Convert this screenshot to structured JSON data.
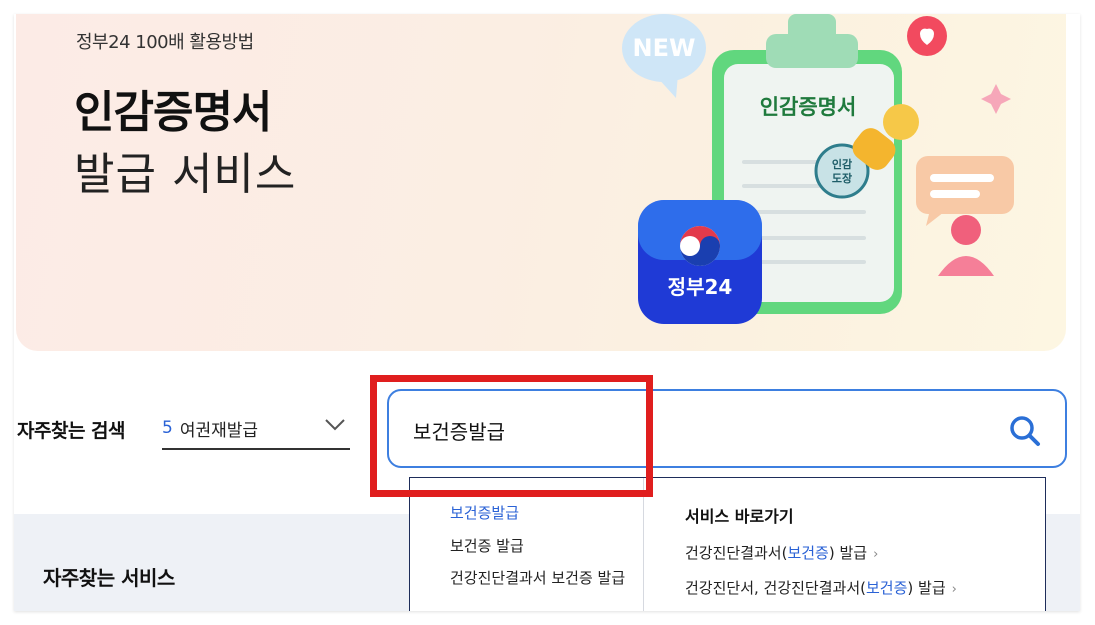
{
  "banner": {
    "kicker": "정부24 100배 활용방법",
    "title": "인감증명서",
    "subtitle": "발급 서비스",
    "illustration": {
      "bubble_text": "NEW",
      "clipboard_text": "인감증명서",
      "stamp_text_line1": "인감",
      "stamp_text_line2": "도장",
      "app_icon_label": "정부24"
    }
  },
  "faq": {
    "label": "자주찾는 검색",
    "selected_number": "5",
    "selected_text": "여권재발급"
  },
  "search": {
    "value": "보건증발급"
  },
  "suggestions": {
    "items": [
      "보건증발급",
      "보건증 발급",
      "건강진단결과서 보건증 발급"
    ]
  },
  "shortcuts": {
    "title": "서비스 바로가기",
    "items": [
      {
        "pre": "건강진단결과서(",
        "hl": "보건증",
        "post": ") 발급"
      },
      {
        "pre": "건강진단서, 건강진단결과서(",
        "hl": "보건증",
        "post": ") 발급"
      }
    ]
  },
  "section": {
    "title": "자주찾는 서비스"
  },
  "colors": {
    "accent_blue": "#2a62d6",
    "search_border": "#3d7fe0",
    "highlight_red": "#e01e1e",
    "section_bg": "#eef1f6"
  },
  "icons": [
    "chevron-down-icon",
    "search-icon",
    "chevron-right-icon"
  ]
}
